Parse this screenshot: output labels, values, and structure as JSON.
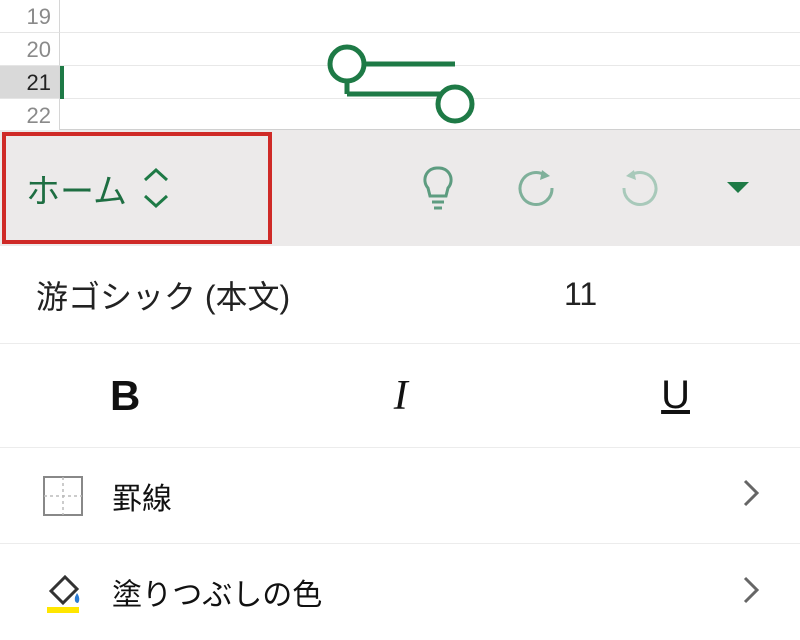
{
  "rows": [
    "19",
    "20",
    "21",
    "22"
  ],
  "selected_row_index": 2,
  "ribbon": {
    "tab_label": "ホーム",
    "icons": {
      "bulb": "bulb",
      "undo": "undo",
      "redo": "redo",
      "dropdown": "dropdown"
    }
  },
  "font": {
    "name": "游ゴシック (本文)",
    "size": "11"
  },
  "format_buttons": {
    "bold": "B",
    "italic": "I",
    "underline": "U"
  },
  "items": {
    "borders": {
      "label": "罫線"
    },
    "fill": {
      "label": "塗りつぶしの色"
    }
  },
  "colors": {
    "accent": "#1e7a46",
    "highlight": "#cf2a27"
  }
}
